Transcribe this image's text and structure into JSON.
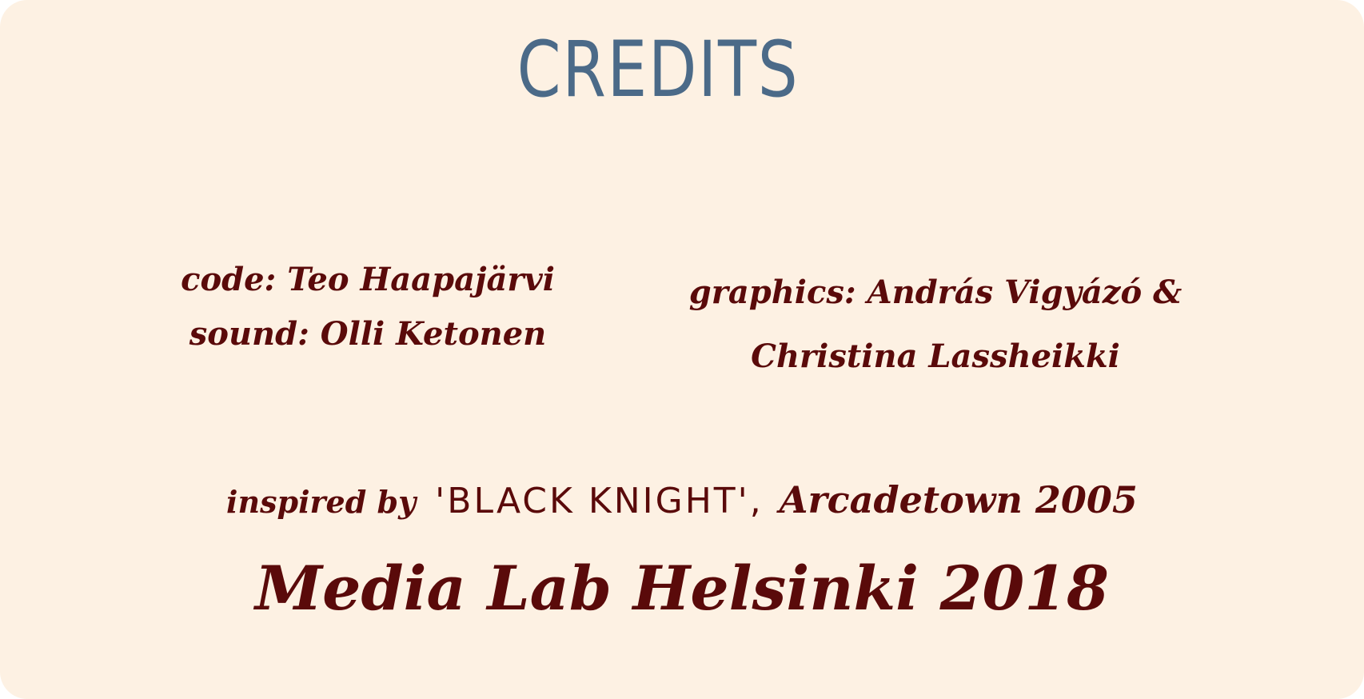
{
  "title": "CREDITS",
  "credits": {
    "code": "code: Teo Haapajärvi",
    "sound": "sound: Olli Ketonen",
    "graphics_line1": "graphics: András Vigyázó &",
    "graphics_line2": "Christina Lassheikki"
  },
  "inspiration": {
    "prefix": "inspired by",
    "game": "'BLACK KNIGHT',",
    "source": "Arcadetown 2005"
  },
  "footer": "Media Lab Helsinki 2018",
  "colors": {
    "background": "#fdf1e3",
    "title": "#4b6a88",
    "text": "#5a0a0a"
  }
}
